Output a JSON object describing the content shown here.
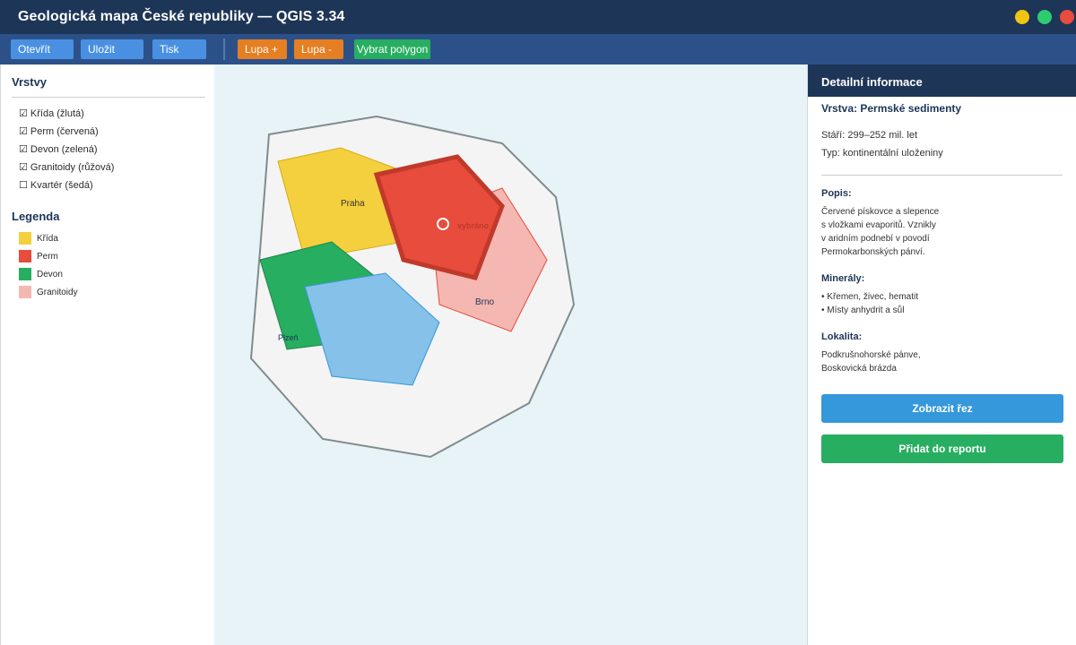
{
  "window": {
    "title": "Geologická mapa České republiky — QGIS 3.34",
    "controls": {
      "minimize_color": "#f1c40f",
      "maximize_color": "#2ecc71",
      "close_color": "#e74c3c"
    }
  },
  "toolbar": {
    "open_label": "Otevřít",
    "save_label": "Uložit",
    "print_label": "Tisk",
    "zoom_in_label": "Lupa +",
    "zoom_out_label": "Lupa -",
    "select_polygon_label": "Vybrat polygon"
  },
  "layers_panel": {
    "title": "Vrstvy",
    "items": [
      {
        "label": "☑ Křída (žlutá)"
      },
      {
        "label": "☑ Perm (červená)"
      },
      {
        "label": "☑ Devon (zelená)"
      },
      {
        "label": "☑ Granitoidy (růžová)"
      },
      {
        "label": "☐ Kvartér (šedá)"
      }
    ]
  },
  "legend": {
    "title": "Legenda",
    "items": [
      {
        "label": "Křída",
        "color": "#f4d03f"
      },
      {
        "label": "Perm",
        "color": "#e74c3c"
      },
      {
        "label": "Devon",
        "color": "#27ae60"
      },
      {
        "label": "Granitoidy",
        "color": "#f5b7b1"
      }
    ]
  },
  "map": {
    "labels": {
      "praha": "Praha",
      "brno": "Brno",
      "plzen": "Plzeň",
      "selected": "vybráno"
    },
    "colors": {
      "boundary_fill": "#f4f4f4",
      "boundary_stroke": "#7f8c8d",
      "kvarter_fill": "#85c1e9",
      "kvarter_stroke": "#3498db"
    }
  },
  "details": {
    "header": "Detailní informace",
    "layer_name": "Vrstva: Permské sedimenty",
    "age": "Stáří: 299–252 mil. let",
    "type": "Typ: kontinentální uloženiny",
    "description_title": "Popis:",
    "description_lines": [
      "Červené pískovce a slepence",
      "s vložkami evaporitů. Vznikly",
      "v aridním podnebí v povodí",
      "Permokarbonských pánví."
    ],
    "minerals_title": "Minerály:",
    "minerals": [
      "• Křemen, živec, hematit",
      "• Místy anhydrit a sůl"
    ],
    "locality_title": "Lokalita:",
    "locality_lines": [
      "Podkrušnohorské pánve,",
      "Boskovická brázda"
    ],
    "show_section_label": "Zobrazit řez",
    "add_report_label": "Přidat do reportu"
  }
}
